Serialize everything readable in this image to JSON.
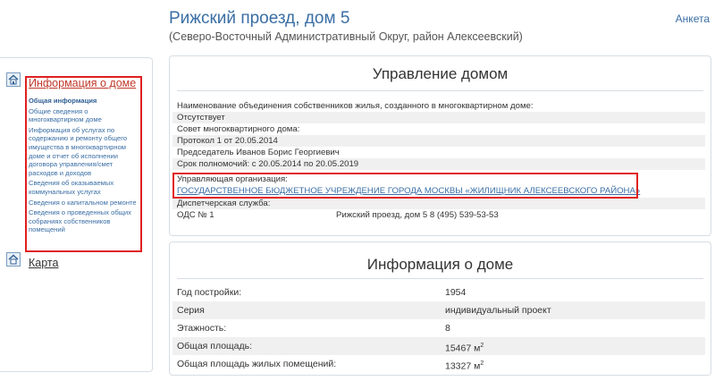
{
  "header": {
    "title": "Рижский проезд, дом 5",
    "subtitle": "(Северо-Восточный Административный Округ, район Алексеевский)",
    "top_link": "Анкета"
  },
  "sidebar": {
    "section_info": "Информация о доме",
    "sub_items": [
      "Общая информация",
      "Общие сведения о многоквартирном доме",
      "Информация об услугах по содержанию и ремонту общего имущества в многоквартирном доме и отчет об исполнении договора управления/смет расходов и доходов",
      "Сведения об оказываемых коммунальных услугах",
      "Сведения о капитальном ремонте",
      "Сведения о проведенных общих собраниях собственников помещений"
    ],
    "section_map": "Карта"
  },
  "management": {
    "title": "Управление домом",
    "association_label": "Наименование объединения собственников жилья, созданного в многоквартирном доме:",
    "association_value": "Отсутствует",
    "council_label": "Совет многоквартирного дома:",
    "protocol": "Протокол 1 от 20.05.2014",
    "chairman": "Председатель Иванов Борис Георгиевич",
    "term": "Срок полномочий: с 20.05.2014 по 20.05.2019",
    "org_label": "Управляющая организация:",
    "org_value": "ГОСУДАРСТВЕННОЕ БЮДЖЕТНОЕ УЧРЕЖДЕНИЕ ГОРОДА МОСКВЫ «ЖИЛИЩНИК АЛЕКСЕЕВСКОГО РАЙОНА»",
    "dispatch_label": "Диспетчерская служба:",
    "dispatch_name": "ОДС № 1",
    "dispatch_address": "Рижский проезд, дом 5 8 (495) 539-53-53"
  },
  "house_info": {
    "title": "Информация о доме",
    "rows": [
      {
        "label": "Год постройки:",
        "value": "1954",
        "sup": ""
      },
      {
        "label": "Серия",
        "value": "индивидуальный проект",
        "sup": ""
      },
      {
        "label": "Этажность:",
        "value": "8",
        "sup": ""
      },
      {
        "label": "Общая площадь:",
        "value": "15467 м",
        "sup": "2"
      },
      {
        "label": "Общая площадь жилых помещений:",
        "value": "13327 м",
        "sup": "2"
      }
    ]
  },
  "colors": {
    "link": "#3a6ea5",
    "highlight_frame": "#e02020",
    "band": "#f0f0f0"
  },
  "icons": [
    "house-icon",
    "map-house-icon"
  ]
}
